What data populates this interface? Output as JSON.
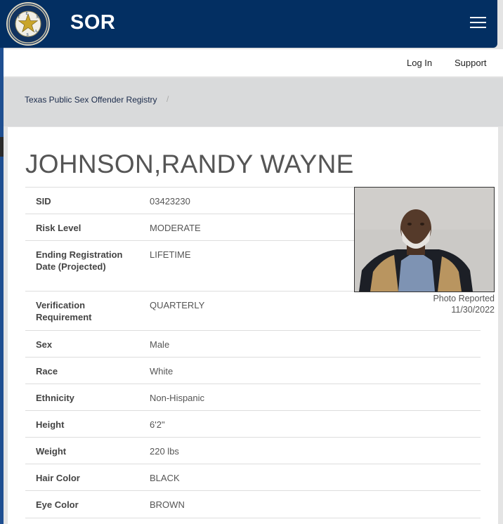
{
  "header": {
    "brand": "SOR",
    "menu_icon": "hamburger-menu-icon",
    "seal_icon": "dps-seal-icon",
    "seal_letters": [
      "T",
      "E",
      "X",
      "A",
      "S"
    ],
    "seal_ring_text": "DEPARTMENT OF PUBLIC SAFETY"
  },
  "nav": {
    "login": "Log In",
    "support": "Support"
  },
  "breadcrumb": {
    "item": "Texas Public Sex Offender Registry",
    "separator": "/"
  },
  "offender": {
    "name": "JOHNSON,RANDY WAYNE",
    "photo_caption_line1": "Photo Reported",
    "photo_caption_line2": "11/30/2022",
    "details": [
      {
        "label": "SID",
        "value": "03423230"
      },
      {
        "label": "Risk Level",
        "value": "MODERATE"
      },
      {
        "label": "Ending Registration Date (Projected)",
        "value": "LIFETIME"
      },
      {
        "label": "Verification Requirement",
        "value": "QUARTERLY"
      },
      {
        "label": "Sex",
        "value": "Male"
      },
      {
        "label": "Race",
        "value": "White"
      },
      {
        "label": "Ethnicity",
        "value": "Non-Hispanic"
      },
      {
        "label": "Height",
        "value": "6'2\""
      },
      {
        "label": "Weight",
        "value": "220 lbs"
      },
      {
        "label": "Hair Color",
        "value": "BLACK"
      },
      {
        "label": "Eye Color",
        "value": "BROWN"
      }
    ]
  },
  "colors": {
    "header_bg": "#032f62",
    "breadcrumb_bg": "#d9dadb",
    "accent": "#1f4f91"
  }
}
